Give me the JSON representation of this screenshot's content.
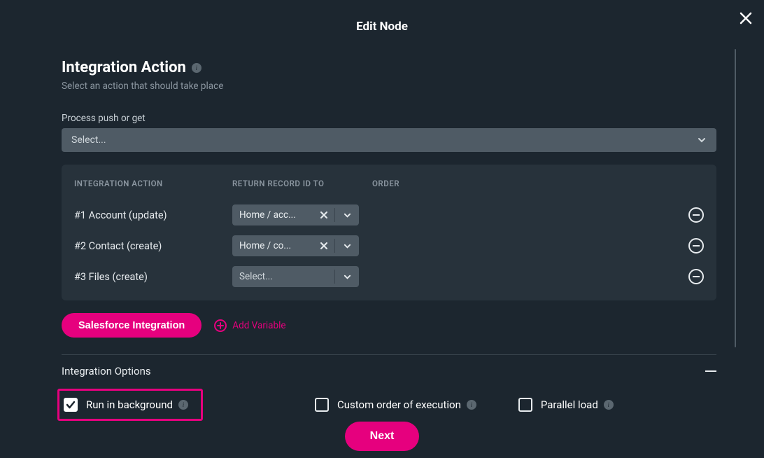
{
  "modal": {
    "title": "Edit Node"
  },
  "section": {
    "title": "Integration Action",
    "subtitle": "Select an action that should take place"
  },
  "process_field": {
    "label": "Process push or get",
    "placeholder": "Select..."
  },
  "table": {
    "headers": {
      "action": "INTEGRATION ACTION",
      "return": "RETURN RECORD ID TO",
      "order": "ORDER"
    },
    "rows": [
      {
        "label": "#1 Account (update)",
        "return_label": "Home / acc...",
        "has_value": true
      },
      {
        "label": "#2 Contact (create)",
        "return_label": "Home / co...",
        "has_value": true
      },
      {
        "label": "#3 Files (create)",
        "return_label": "Select...",
        "has_value": false
      }
    ]
  },
  "buttons": {
    "integration": "Salesforce Integration",
    "add_variable": "Add Variable",
    "next": "Next"
  },
  "options": {
    "title": "Integration Options",
    "items": [
      {
        "label": "Run in background",
        "checked": true,
        "highlighted": true
      },
      {
        "label": "Custom order of execution",
        "checked": false,
        "highlighted": false
      },
      {
        "label": "Parallel load",
        "checked": false,
        "highlighted": false
      }
    ]
  }
}
